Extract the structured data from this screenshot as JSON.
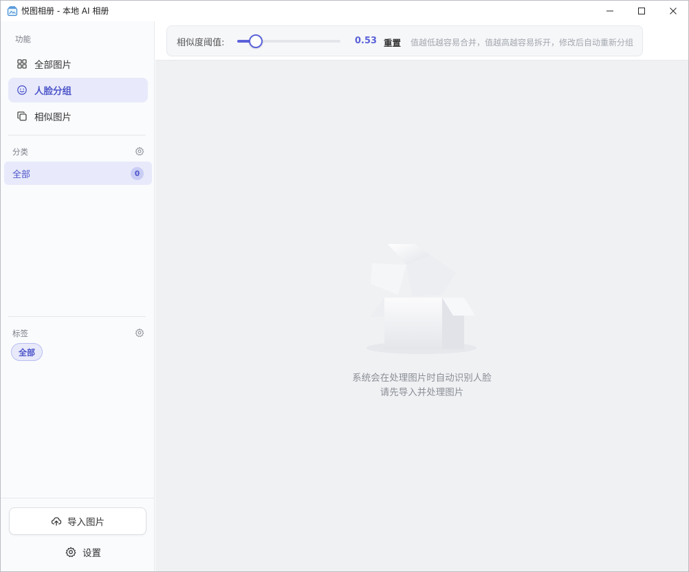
{
  "window": {
    "title": "悦图相册 - 本地 AI 相册",
    "controls": {
      "minimize": "minimize",
      "maximize": "maximize",
      "close": "close"
    }
  },
  "sidebar": {
    "functions_label": "功能",
    "nav": [
      {
        "label": "全部图片",
        "icon": "grid-icon",
        "active": false
      },
      {
        "label": "人脸分组",
        "icon": "smile-icon",
        "active": true
      },
      {
        "label": "相似图片",
        "icon": "copy-icon",
        "active": false
      }
    ],
    "categories_label": "分类",
    "categories": [
      {
        "label": "全部",
        "count": "0"
      }
    ],
    "tags_label": "标签",
    "tags": [
      {
        "label": "全部"
      }
    ],
    "import_label": "导入图片",
    "settings_label": "设置"
  },
  "toolbar": {
    "threshold_label": "相似度阈值:",
    "threshold_value": "0.53",
    "slider_fraction": 0.18,
    "reset_label": "重置",
    "hint": "值越低越容易合并，值越高越容易拆开，修改后自动重新分组"
  },
  "empty_state": {
    "line1": "系统会在处理图片时自动识别人脸",
    "line2": "请先导入并处理图片"
  },
  "colors": {
    "accent": "#5b62d9",
    "active_bg": "#e8eafb",
    "main_bg": "#f0f1f3"
  }
}
